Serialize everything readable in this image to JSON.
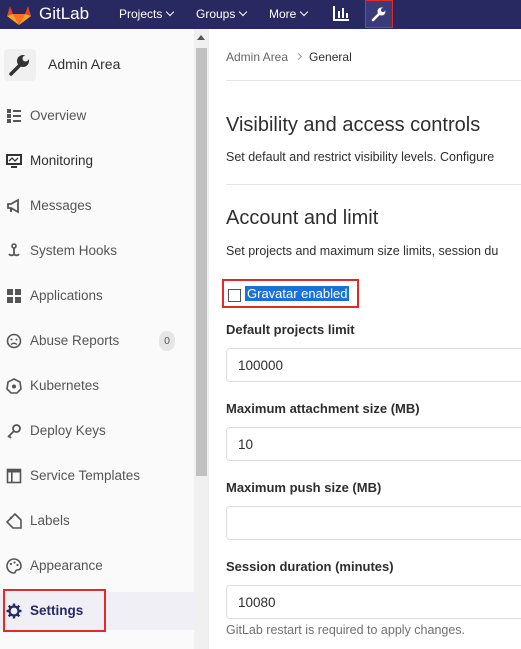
{
  "navbar": {
    "brand": "GitLab",
    "items": [
      {
        "label": "Projects",
        "icon": "chevron-down-icon"
      },
      {
        "label": "Groups",
        "icon": "chevron-down-icon"
      },
      {
        "label": "More",
        "icon": "chevron-down-icon"
      }
    ],
    "icons": [
      "gitlab-logo",
      "activity-chart-icon",
      "admin-wrench-icon"
    ],
    "color": "#292961"
  },
  "sidebar": {
    "title": "Admin Area",
    "items": [
      {
        "label": "Overview",
        "icon": "overview-icon"
      },
      {
        "label": "Monitoring",
        "icon": "monitor-icon"
      },
      {
        "label": "Messages",
        "icon": "megaphone-icon"
      },
      {
        "label": "System Hooks",
        "icon": "hook-icon"
      },
      {
        "label": "Applications",
        "icon": "applications-icon"
      },
      {
        "label": "Abuse Reports",
        "icon": "abuse-icon",
        "badge": "0"
      },
      {
        "label": "Kubernetes",
        "icon": "kubernetes-icon"
      },
      {
        "label": "Deploy Keys",
        "icon": "key-icon"
      },
      {
        "label": "Service Templates",
        "icon": "template-icon"
      },
      {
        "label": "Labels",
        "icon": "label-icon"
      },
      {
        "label": "Appearance",
        "icon": "palette-icon"
      },
      {
        "label": "Settings",
        "icon": "settings-gear-icon",
        "active": true
      }
    ]
  },
  "breadcrumb": {
    "parent": "Admin Area",
    "current": "General"
  },
  "sections": [
    {
      "title": "Visibility and access controls",
      "description": "Set default and restrict visibility levels. Configure"
    },
    {
      "title": "Account and limit",
      "description": "Set projects and maximum size limits, session du"
    }
  ],
  "form": {
    "gravatar_label": "Gravatar enabled",
    "gravatar_checked": false,
    "fields": [
      {
        "label": "Default projects limit",
        "value": "100000"
      },
      {
        "label": "Maximum attachment size (MB)",
        "value": "10"
      },
      {
        "label": "Maximum push size (MB)",
        "value": ""
      },
      {
        "label": "Session duration (minutes)",
        "value": "10080"
      }
    ],
    "help": "GitLab restart is required to apply changes."
  }
}
